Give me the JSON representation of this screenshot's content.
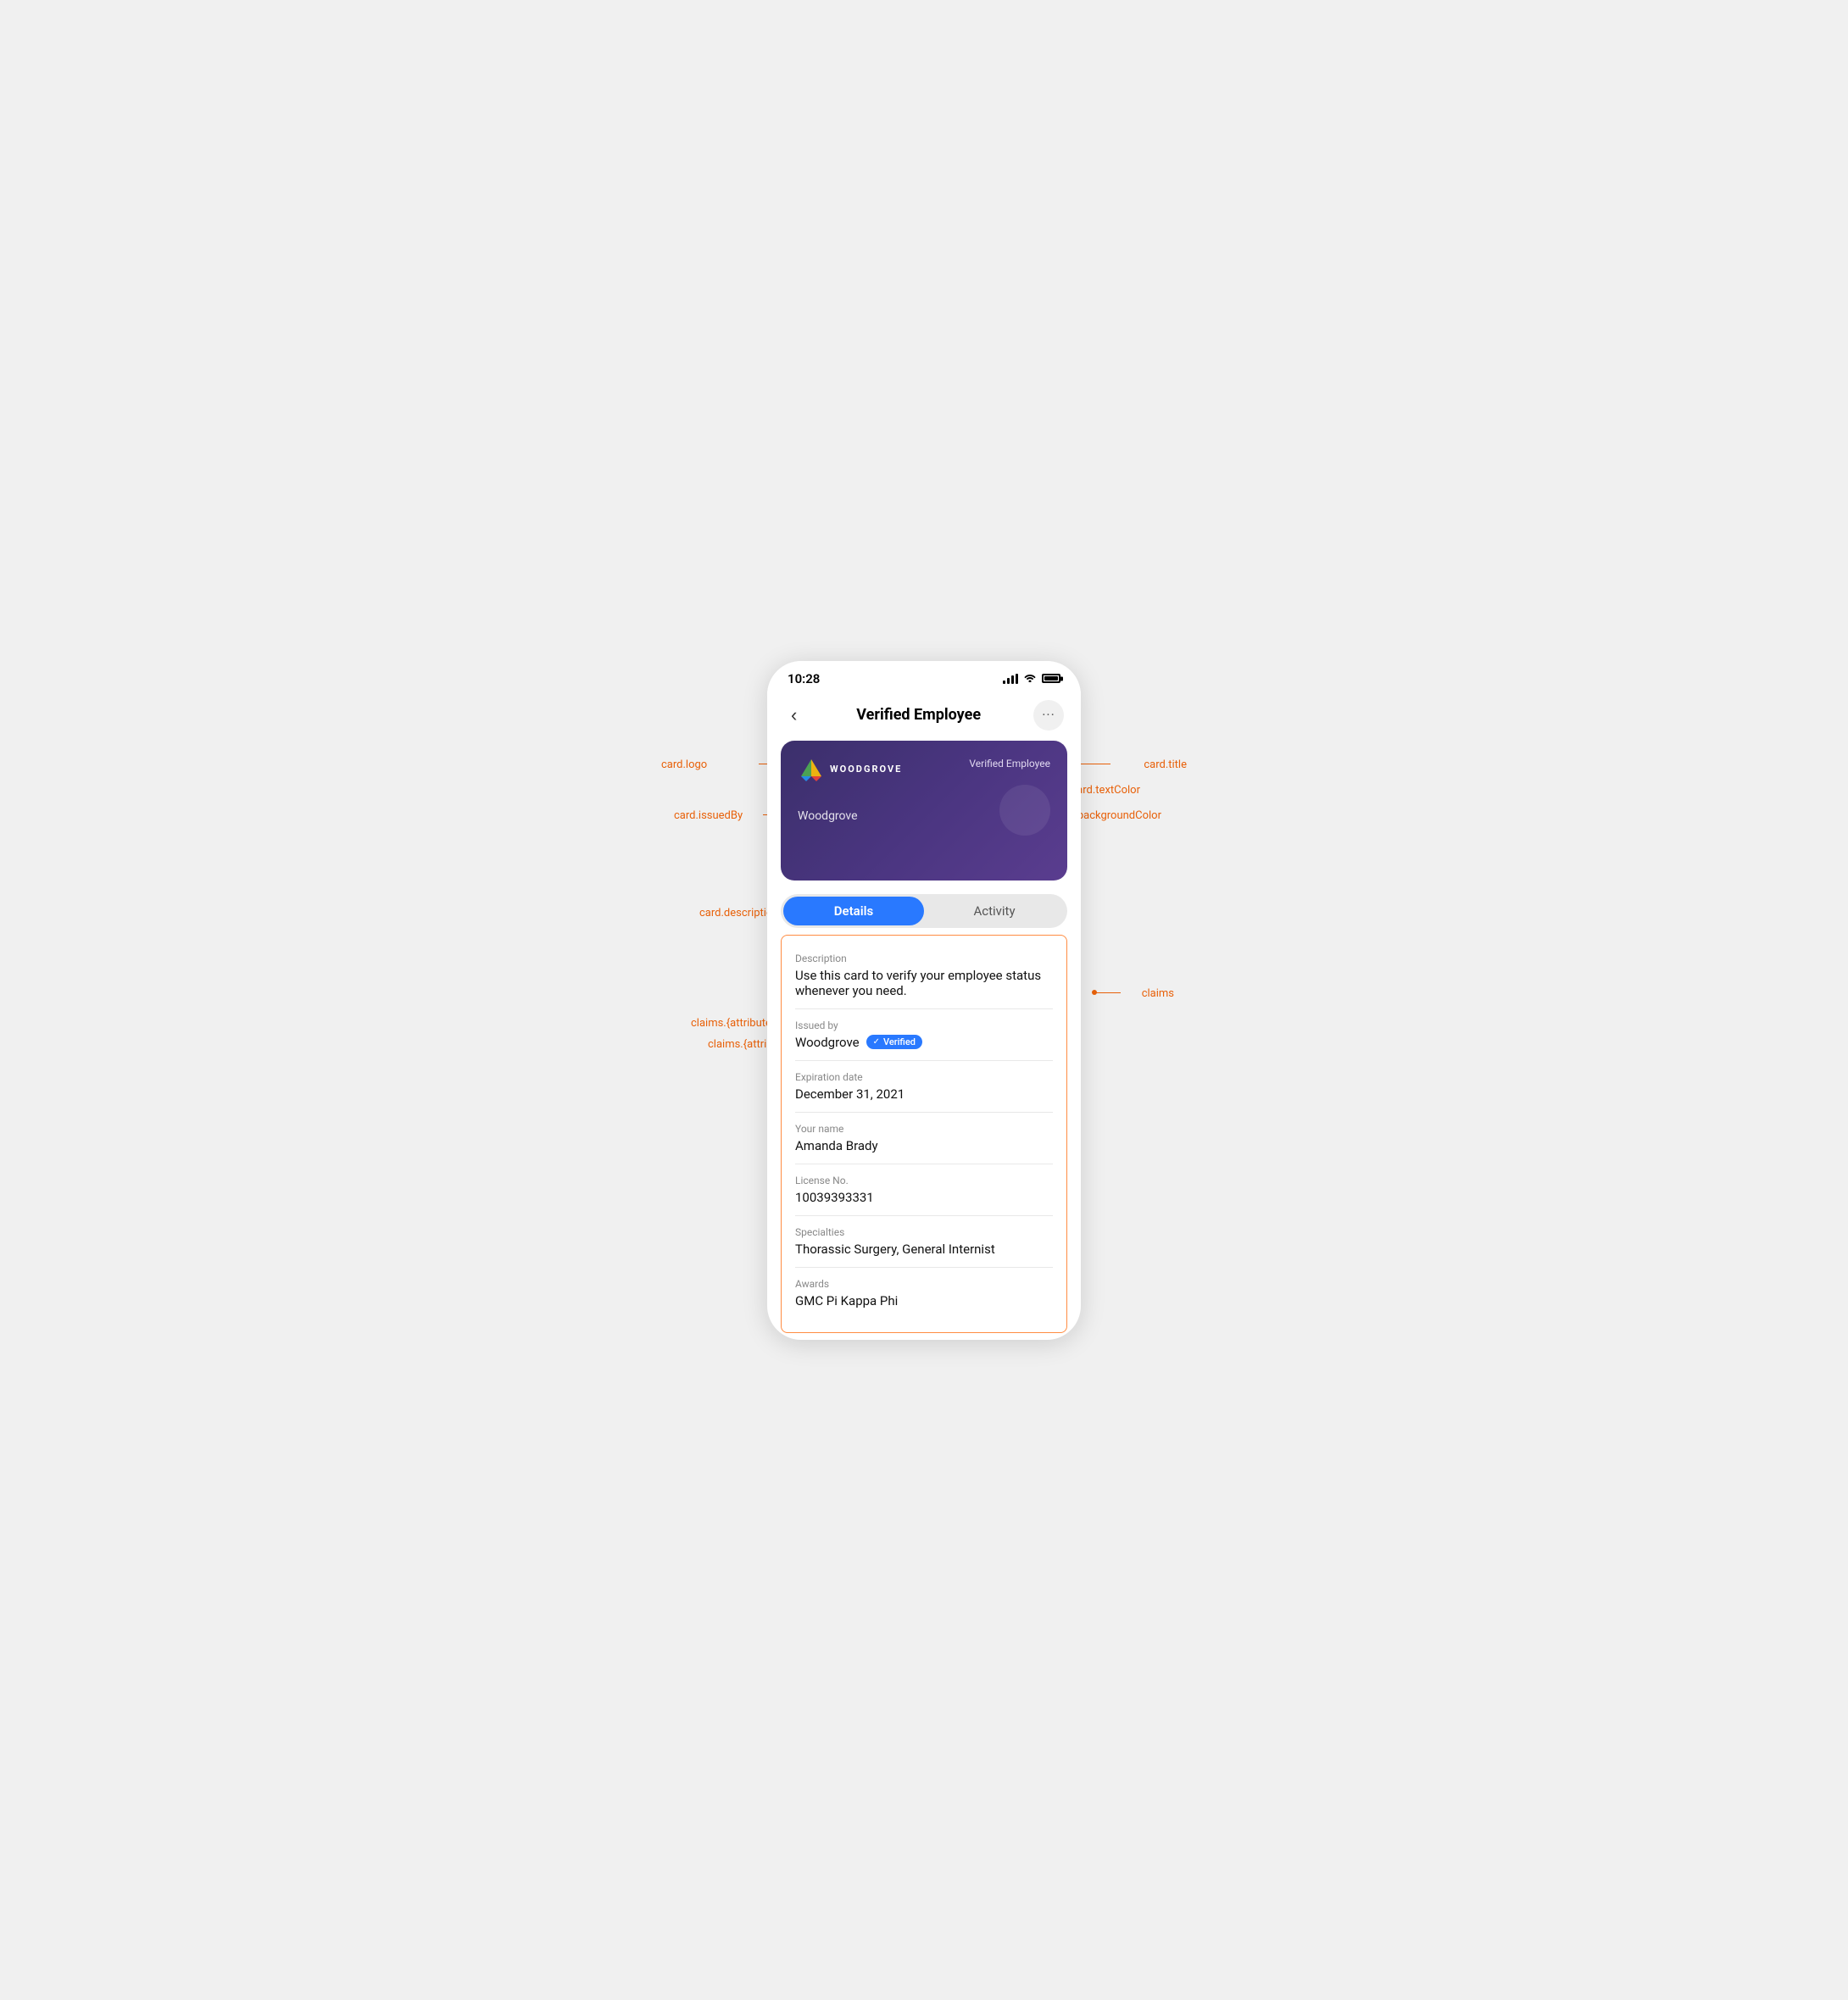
{
  "page": {
    "background": "#f0f0f0"
  },
  "statusBar": {
    "time": "10:28"
  },
  "nav": {
    "title": "Verified Employee",
    "back_label": "‹",
    "more_label": "···"
  },
  "card": {
    "logo": "WOODGROVE",
    "title": "Verified Employee",
    "issuedBy": "Woodgrove",
    "backgroundColor": "#4a3580",
    "textColor": "#ffffff"
  },
  "tabs": {
    "details_label": "Details",
    "activity_label": "Activity"
  },
  "description": {
    "label": "Description",
    "value": "Use this card to verify your employee status whenever you need."
  },
  "issuedBy": {
    "label": "Issued by",
    "value": "Woodgrove",
    "verified_label": "Verified"
  },
  "expirationDate": {
    "label": "Expiration date",
    "value": "December 31, 2021"
  },
  "claims": [
    {
      "label": "Your name",
      "value": "Amanda Brady"
    },
    {
      "label": "License No.",
      "value": "10039393331"
    },
    {
      "label": "Specialties",
      "value": "Thorassic Surgery, General Internist"
    },
    {
      "label": "Awards",
      "value": "GMC Pi Kappa Phi"
    }
  ],
  "annotations": {
    "card_logo": "card.logo",
    "card_title": "card.title",
    "card_text_color_1": "card.textColor",
    "card_text_color_2": "card.textColor",
    "card_issued_by": "card.issuedBy",
    "card_bg_color": "card.backgroundColor",
    "card_description": "card.description",
    "claims_label": "claims.{attribute}.label",
    "claims_value": "claims.{attribute}",
    "claims_section": "claims"
  }
}
